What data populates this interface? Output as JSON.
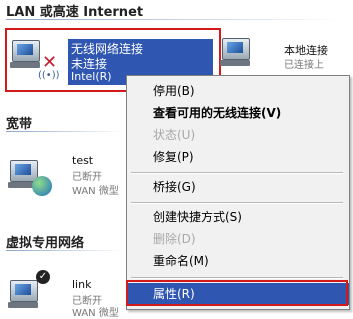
{
  "sections": {
    "lan": "LAN 或高速 Internet",
    "broadband": "宽带",
    "vpn": "虚拟专用网络"
  },
  "connections": {
    "wireless": {
      "name": "无线网络连接",
      "status": "未连接",
      "device": "Intel(R)"
    },
    "local": {
      "name": "本地连接",
      "status": "已连接上"
    },
    "test": {
      "name": "test",
      "status": "已断开",
      "device": "WAN 微型"
    },
    "link": {
      "name": "link",
      "status": "已断开",
      "device": "WAN 微型"
    }
  },
  "menu": {
    "items": [
      {
        "label": "停用(B)",
        "style": "normal"
      },
      {
        "label": "查看可用的无线连接(V)",
        "style": "bold"
      },
      {
        "label": "状态(U)",
        "style": "disabled"
      },
      {
        "label": "修复(P)",
        "style": "normal"
      },
      {
        "label": "桥接(G)",
        "style": "normal"
      },
      {
        "label": "创建快捷方式(S)",
        "style": "normal"
      },
      {
        "label": "删除(D)",
        "style": "disabled"
      },
      {
        "label": "重命名(M)",
        "style": "normal"
      },
      {
        "label": "属性(R)",
        "style": "highlighted"
      }
    ]
  },
  "colors": {
    "selection": "#2f56b0",
    "annotation": "#d21a1a"
  }
}
